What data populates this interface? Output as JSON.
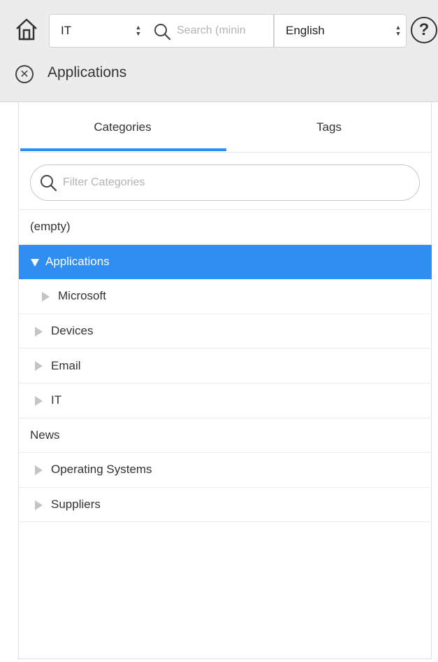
{
  "toolbar": {
    "category_select": "IT",
    "search_placeholder": "Search (minin",
    "language_select": "English",
    "help_label": "?"
  },
  "section": {
    "title": "Applications"
  },
  "tabs": [
    {
      "label": "Categories",
      "active": true
    },
    {
      "label": "Tags",
      "active": false
    }
  ],
  "filter": {
    "placeholder": "Filter Categories"
  },
  "tree": [
    {
      "label": "(empty)",
      "expander": "none",
      "selected": false,
      "level": 0
    },
    {
      "label": "Applications",
      "expander": "expanded",
      "selected": true,
      "level": 0
    },
    {
      "label": "Microsoft",
      "expander": "collapsed",
      "selected": false,
      "level": 1
    },
    {
      "label": "Devices",
      "expander": "collapsed",
      "selected": false,
      "level": 0
    },
    {
      "label": "Email",
      "expander": "collapsed",
      "selected": false,
      "level": 0
    },
    {
      "label": "IT",
      "expander": "collapsed",
      "selected": false,
      "level": 0
    },
    {
      "label": "News",
      "expander": "none",
      "selected": false,
      "level": 0
    },
    {
      "label": "Operating Systems",
      "expander": "collapsed",
      "selected": false,
      "level": 0
    },
    {
      "label": "Suppliers",
      "expander": "collapsed",
      "selected": false,
      "level": 0
    }
  ],
  "colors": {
    "accent": "#2f8ef2",
    "toolbar_bg": "#ececec",
    "caret": "#c4c4c4"
  }
}
